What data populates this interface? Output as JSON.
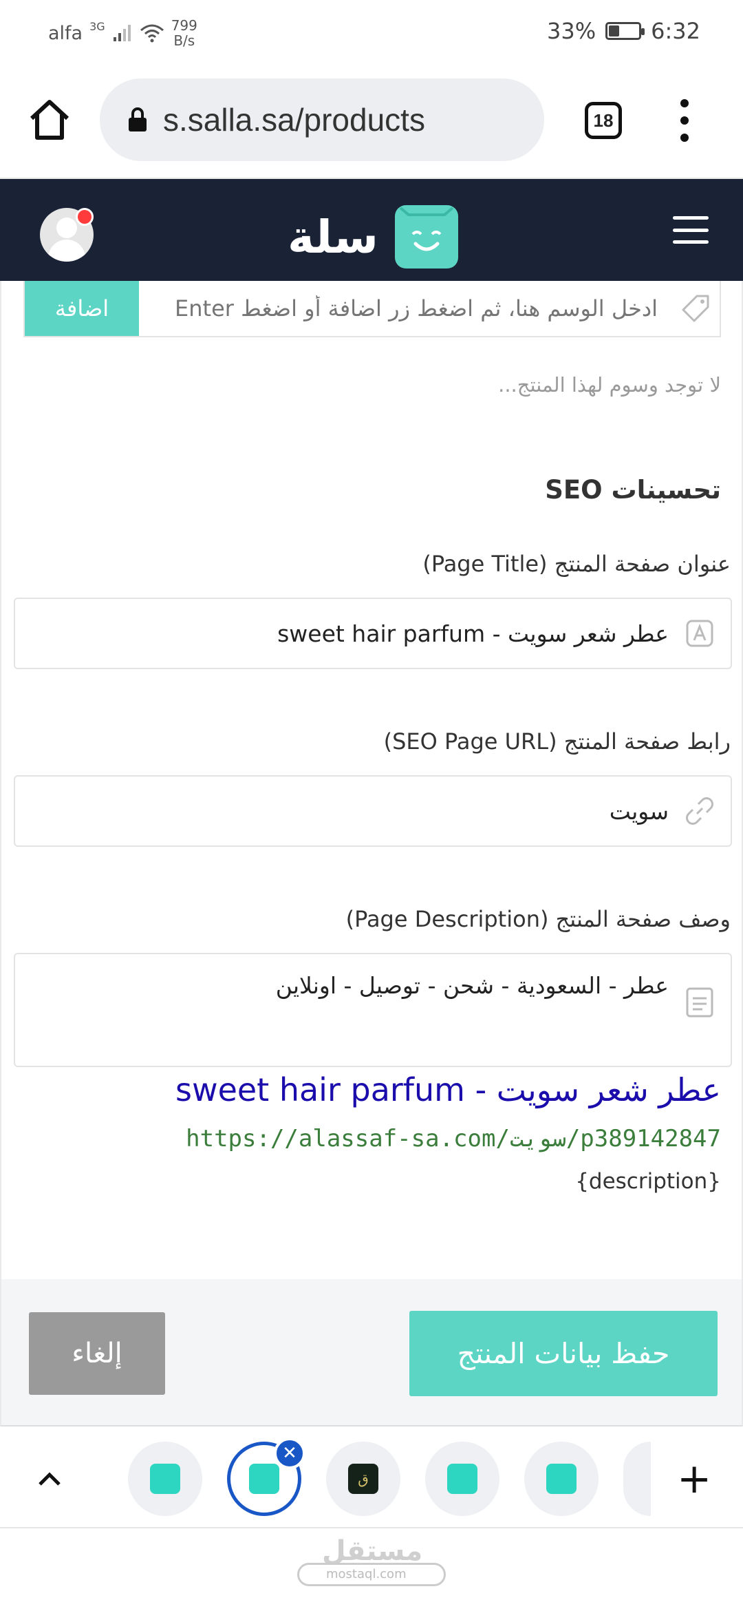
{
  "status_bar": {
    "carrier": "alfa",
    "network": "3G",
    "speed_value": "799",
    "speed_unit": "B/s",
    "battery": "33%",
    "battery_level": 0.33,
    "time": "6:32"
  },
  "browser": {
    "url": "s.salla.sa/products",
    "tab_count": "18"
  },
  "header": {
    "logo_text": "سلة"
  },
  "tags": {
    "add_label": "اضافة",
    "input_placeholder": "ادخل الوسم هنا، ثم اضغط زر اضافة أو اضغط Enter",
    "empty_text": "لا توجد وسوم لهذا المنتج..."
  },
  "seo": {
    "section_title": "تحسينات SEO",
    "page_title_label": "عنوان صفحة المنتج (Page Title)",
    "page_title_value": "عطر شعر سويت  -  sweet hair parfum",
    "page_url_label": "رابط صفحة المنتج (SEO Page URL)",
    "page_url_value": "سويت",
    "page_desc_label": "وصف صفحة المنتج (Page Description)",
    "page_desc_value": "عطر - السعودية - شحن - توصيل  -  اونلاين"
  },
  "preview": {
    "title": "عطر شعر سويت - sweet hair parfum",
    "url": "https://alassaf-sa.com/سويت/p389142847",
    "description": "{description}"
  },
  "actions": {
    "cancel_label": "إلغاء",
    "save_label": "حفظ بيانات المنتج"
  },
  "watermark": {
    "text": "مستقل",
    "sub": "mostaql.com"
  },
  "colors": {
    "brand": "#5dd5c4",
    "header_bg": "#1a2236",
    "link_blue": "#1a0dab",
    "url_green": "#3b7d3b",
    "cancel_gray": "#9a9a9a",
    "active_tab": "#1a57c6"
  }
}
